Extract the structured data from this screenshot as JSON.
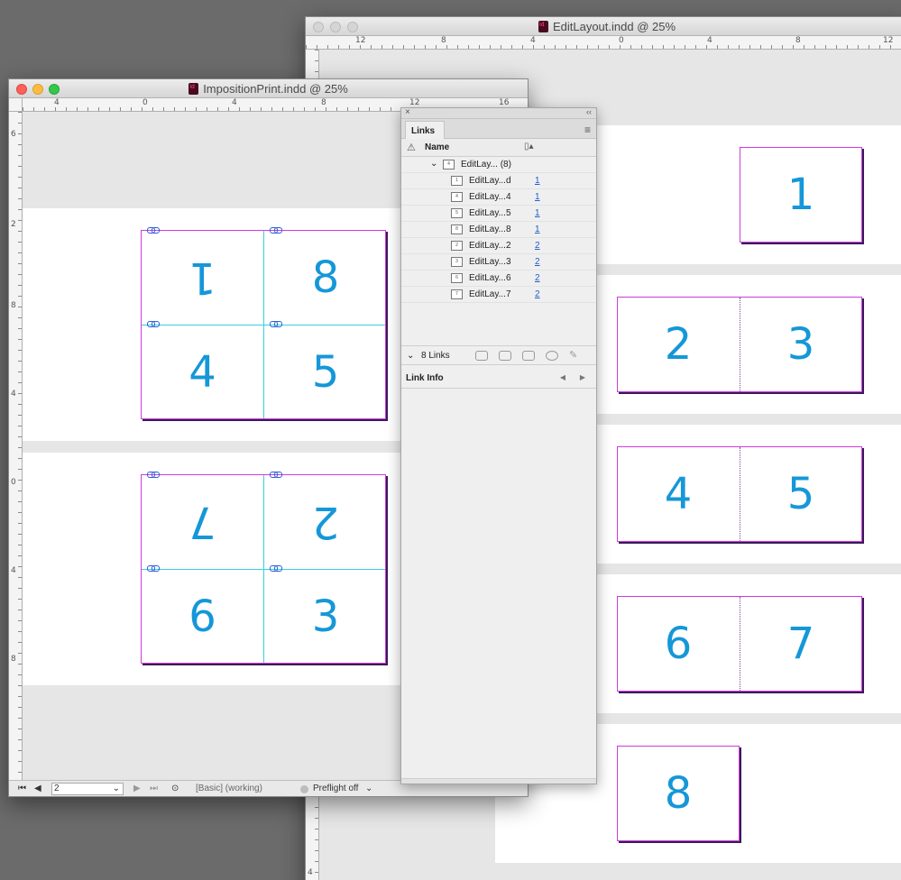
{
  "edit_window": {
    "title": "EditLayout.indd @ 25%",
    "ruler_numbers": [
      "12",
      "8",
      "4",
      "0",
      "4",
      "8",
      "12",
      "4"
    ],
    "vruler_numbers": [
      "8",
      "4"
    ],
    "pages": {
      "p1": "1",
      "p2": "2",
      "p3": "3",
      "p4": "4",
      "p5": "5",
      "p6": "6",
      "p7": "7",
      "p8": "8"
    }
  },
  "imposition_window": {
    "title": "ImpositionPrint.indd @ 25%",
    "ruler_numbers": [
      "4",
      "0",
      "4",
      "8",
      "12",
      "16"
    ],
    "vruler_numbers": [
      "6",
      "2",
      "8",
      "4",
      "0",
      "4",
      "8"
    ],
    "sheet1": {
      "tl": "1",
      "tr": "8",
      "bl": "4",
      "br": "5"
    },
    "sheet2": {
      "tl": "7",
      "tr": "2",
      "bl": "6",
      "br": "3"
    },
    "status": {
      "page_value": "2",
      "working": "[Basic] (working)",
      "preflight": "Preflight off"
    }
  },
  "links_panel": {
    "tab_label": "Links",
    "col_name": "Name",
    "parent": {
      "name": "EditLay... (8)",
      "thumb": "4"
    },
    "rows": [
      {
        "thumb": "1",
        "name": "EditLay...d",
        "page": "1"
      },
      {
        "thumb": "4",
        "name": "EditLay...4",
        "page": "1"
      },
      {
        "thumb": "5",
        "name": "EditLay...5",
        "page": "1"
      },
      {
        "thumb": "8",
        "name": "EditLay...8",
        "page": "1"
      },
      {
        "thumb": "2",
        "name": "EditLay...2",
        "page": "2"
      },
      {
        "thumb": "3",
        "name": "EditLay...3",
        "page": "2"
      },
      {
        "thumb": "6",
        "name": "EditLay...6",
        "page": "2"
      },
      {
        "thumb": "7",
        "name": "EditLay...7",
        "page": "2"
      }
    ],
    "links_count": "8 Links",
    "link_info": "Link Info"
  },
  "colors": {
    "accent_numbers": "#1597d8",
    "frame_magenta": "#d03adf",
    "guide_cyan": "#36d1e0",
    "link_blue": "#1f5fd0"
  }
}
